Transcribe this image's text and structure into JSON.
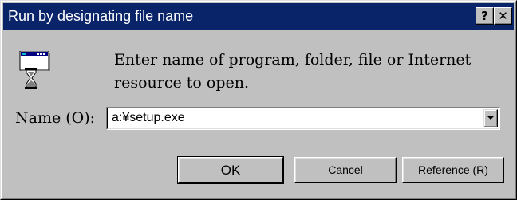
{
  "window": {
    "title": "Run by designating file name",
    "help_glyph": "?",
    "close_glyph": "✕"
  },
  "icon": {
    "name": "run-program-icon"
  },
  "message": "Enter name of program, folder, file or Internet resource to open.",
  "name_field": {
    "label": "Name (O):",
    "value": "a:¥setup.exe"
  },
  "buttons": {
    "ok": "OK",
    "cancel": "Cancel",
    "reference": "Reference (R)"
  },
  "colors": {
    "face": "#c0c0c0",
    "titlebar": "#0a246a",
    "title_text": "#ffffff"
  }
}
